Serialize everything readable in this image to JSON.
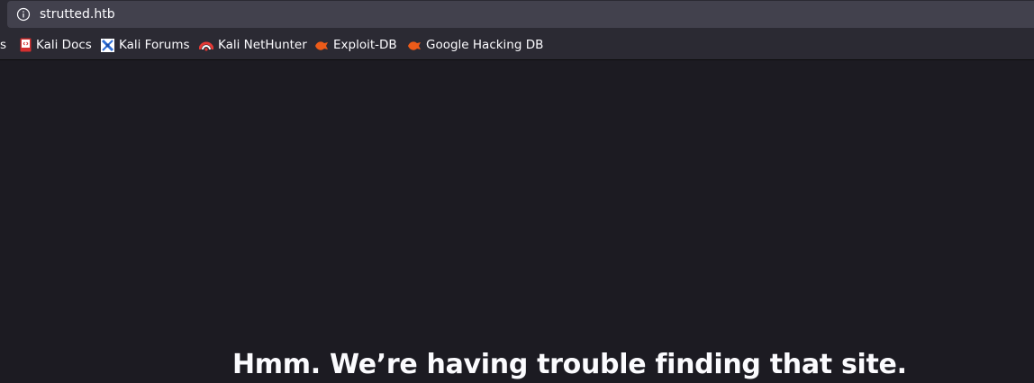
{
  "urlbar": {
    "url": "strutted.htb",
    "icon": "info-icon"
  },
  "bookmarks": {
    "partial_label": "s",
    "items": [
      {
        "label": "Kali Docs",
        "icon": "kali-docs-icon"
      },
      {
        "label": "Kali Forums",
        "icon": "kali-forums-icon"
      },
      {
        "label": "Kali NetHunter",
        "icon": "kali-nethunter-icon"
      },
      {
        "label": "Exploit-DB",
        "icon": "exploit-db-icon"
      },
      {
        "label": "Google Hacking DB",
        "icon": "exploit-db-icon"
      }
    ]
  },
  "error_page": {
    "title": "Hmm. We’re having trouble finding that site."
  },
  "colors": {
    "toolbar": "#2b2a33",
    "urlbar": "#42414d",
    "content_bg": "#1c1b22",
    "text": "#fbfbfe",
    "exploit_orange": "#ec5b19"
  }
}
